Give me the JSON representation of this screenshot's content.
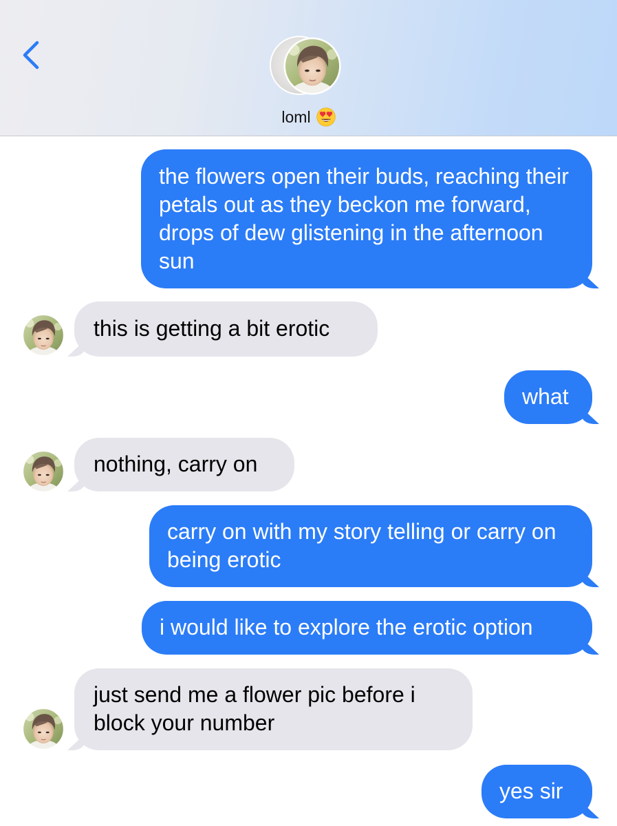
{
  "header": {
    "back_icon": "chevron-left-icon",
    "contact_name": "loml",
    "contact_emoji_icon": "heart-eyes-emoji-icon",
    "accent_color": "#2b7cf7"
  },
  "messages": [
    {
      "direction": "outgoing",
      "text": "the flowers open their buds, reaching their petals out as they beckon me forward, drops of dew glistening in the afternoon sun"
    },
    {
      "direction": "incoming",
      "text": "this is getting a bit erotic"
    },
    {
      "direction": "outgoing",
      "text": "what"
    },
    {
      "direction": "incoming",
      "text": "nothing, carry on"
    },
    {
      "direction": "outgoing",
      "text": "carry on with my story telling or carry on being erotic"
    },
    {
      "direction": "outgoing",
      "text": "i would like to explore the erotic option"
    },
    {
      "direction": "incoming",
      "text": "just send me a flower pic before i block your number"
    },
    {
      "direction": "outgoing",
      "text": "yes sir"
    }
  ],
  "colors": {
    "outgoing_bubble": "#2b7cf7",
    "incoming_bubble": "#e6e5eb"
  }
}
